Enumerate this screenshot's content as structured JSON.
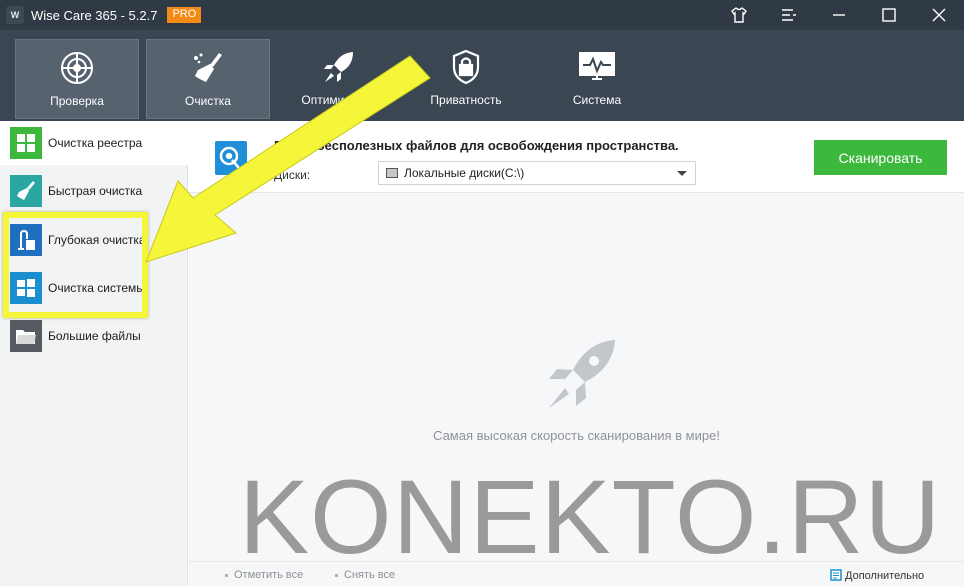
{
  "window": {
    "title": "Wise Care 365 - 5.2.7",
    "badge": "PRO"
  },
  "topnav": {
    "tabs": [
      {
        "label": "Проверка",
        "icon": "radar-icon"
      },
      {
        "label": "Очистка",
        "icon": "broom-icon"
      },
      {
        "label": "Оптимизация",
        "icon": "rocket-icon"
      },
      {
        "label": "Приватность",
        "icon": "lock-shield-icon"
      },
      {
        "label": "Система",
        "icon": "monitor-pulse-icon"
      }
    ]
  },
  "sidebar": {
    "items": [
      {
        "label": "Очистка реестра",
        "icon": "registry-grid-icon",
        "color": "#3cb83c"
      },
      {
        "label": "Быстрая очистка",
        "icon": "broom-icon",
        "color": "#2aa7a1"
      },
      {
        "label": "Глубокая очистка",
        "icon": "vacuum-icon",
        "color": "#1e6fc0"
      },
      {
        "label": "Очистка системы",
        "icon": "windows-icon",
        "color": "#1d8fd0"
      },
      {
        "label": "Большие файлы",
        "icon": "folder-icon",
        "color": "#555b61"
      }
    ]
  },
  "main": {
    "header_title": "Поиск бесполезных файлов для освобождения пространства.",
    "disks_label": "Диски:",
    "disk_value": "Локальные диски(C:\\)",
    "scan_button": "Сканировать",
    "empty_text": "Самая высокая скорость сканирования в мире!"
  },
  "footer": {
    "select_all": "Отметить все",
    "deselect_all": "Снять все",
    "more": "Дополнительно"
  },
  "watermark": "KONEKTO.RU",
  "colors": {
    "titlebar": "#2f3a44",
    "nav": "#3a4753",
    "accent_green": "#3cb83c",
    "highlight_yellow": "#f5f53a"
  }
}
